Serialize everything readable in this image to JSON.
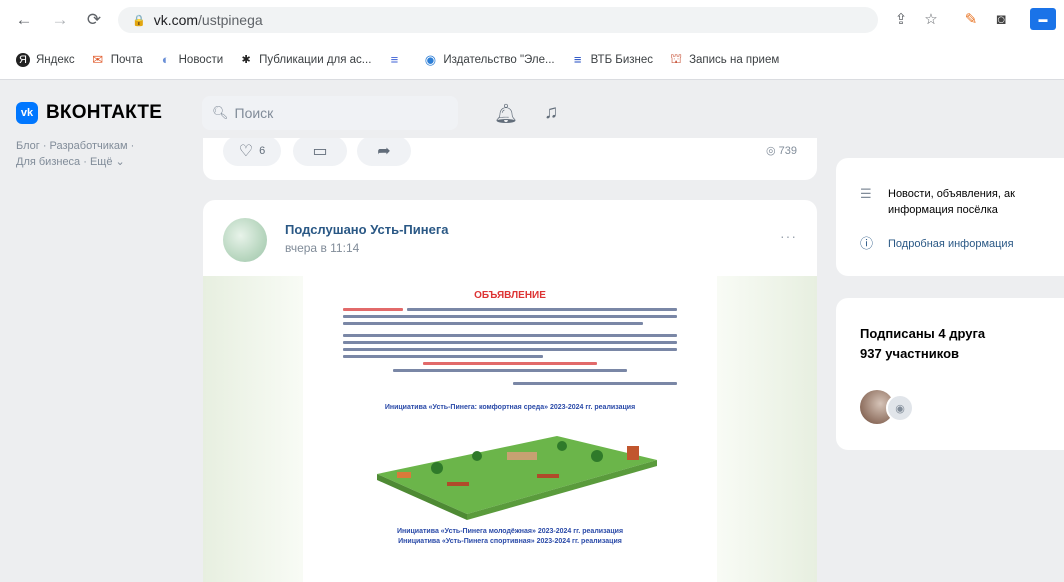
{
  "browser": {
    "url_host": "vk.com",
    "url_path": "/ustpinega",
    "bookmarks": [
      {
        "label": "Яндекс",
        "icon": "yandex-icon",
        "color": "#222222"
      },
      {
        "label": "Почта",
        "icon": "mail-icon",
        "color": "#e05a2a"
      },
      {
        "label": "Новости",
        "icon": "news-icon",
        "color": "#6a8fd6"
      },
      {
        "label": "Публикации для ас...",
        "icon": "publications-icon",
        "color": "#222222"
      },
      {
        "label": "",
        "icon": "lines-icon",
        "color": "#3b5fd6"
      },
      {
        "label": "Издательство \"Эле...",
        "icon": "publisher-icon",
        "color": "#2c7ed6"
      },
      {
        "label": "ВТБ Бизнес",
        "icon": "vtb-icon",
        "color": "#1c48c0"
      },
      {
        "label": "Запись на прием",
        "icon": "appointment-icon",
        "color": "#c44a2e"
      }
    ]
  },
  "vk": {
    "logo_text": "ВКОНТАКТЕ",
    "search_placeholder": "Поиск",
    "left_links": [
      "Блог · Разработчикам ·",
      "Для бизнеса · Ещё ⌄"
    ]
  },
  "prev_post": {
    "likes": "6",
    "views": "739"
  },
  "post": {
    "author": "Подслушано Усть-Пинега",
    "time": "вчера в 11:14",
    "doc": {
      "title": "ОБЪЯВЛЕНИЕ",
      "caption1": "Инициатива «Усть-Пинега: комфортная среда» 2023-2024 гг. реализация",
      "caption2": "Инициатива «Усть-Пинега молодёжная» 2023-2024 гг. реализация",
      "caption3": "Инициатива «Усть-Пинега спортивная» 2023-2024 гг. реализация"
    }
  },
  "sidebar": {
    "info_text1": "Новости, объявления, ак",
    "info_text2": "информация посёлка",
    "info_link": "Подробная информация",
    "members_title": "Подписаны 4 друга",
    "members_count": "937 участников"
  },
  "colors": {
    "vk_blue": "#0077ff",
    "link": "#2a5885"
  }
}
